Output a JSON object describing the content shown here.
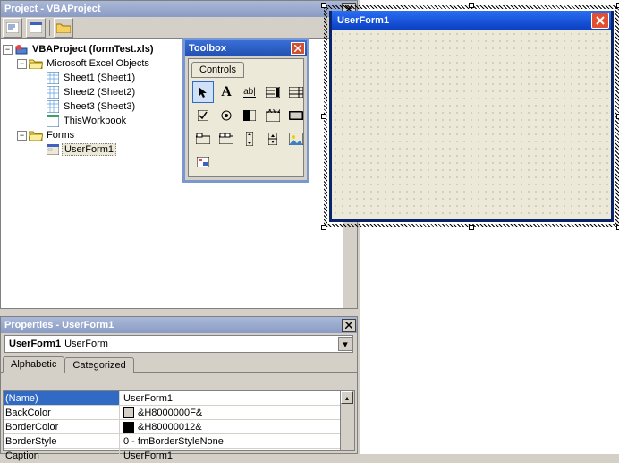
{
  "project_panel": {
    "title": "Project - VBAProject",
    "root": {
      "label": "VBAProject (formTest.xls)"
    },
    "objects_folder": "Microsoft Excel Objects",
    "sheets": [
      "Sheet1 (Sheet1)",
      "Sheet2 (Sheet2)",
      "Sheet3 (Sheet3)"
    ],
    "workbook": "ThisWorkbook",
    "forms_folder": "Forms",
    "forms": [
      "UserForm1"
    ]
  },
  "toolbox": {
    "title": "Toolbox",
    "tab": "Controls",
    "tools": [
      "select",
      "label",
      "textbox",
      "combobox",
      "listbox",
      "checkbox",
      "optionbutton",
      "togglebutton",
      "frame",
      "commandbutton",
      "tabstrip",
      "multipage",
      "scrollbar",
      "spinbutton",
      "image",
      "refedit"
    ]
  },
  "userform": {
    "title": "UserForm1"
  },
  "properties_panel": {
    "title": "Properties - UserForm1",
    "object_name": "UserForm1",
    "object_type": "UserForm",
    "tabs": [
      "Alphabetic",
      "Categorized"
    ],
    "rows": [
      {
        "name": "(Name)",
        "value": "UserForm1",
        "selected": true
      },
      {
        "name": "BackColor",
        "value": "&H8000000F&",
        "swatch": "#d4d0c8"
      },
      {
        "name": "BorderColor",
        "value": "&H80000012&",
        "swatch": "#000000"
      },
      {
        "name": "BorderStyle",
        "value": "0 - fmBorderStyleNone"
      },
      {
        "name": "Caption",
        "value": "UserForm1"
      }
    ]
  }
}
